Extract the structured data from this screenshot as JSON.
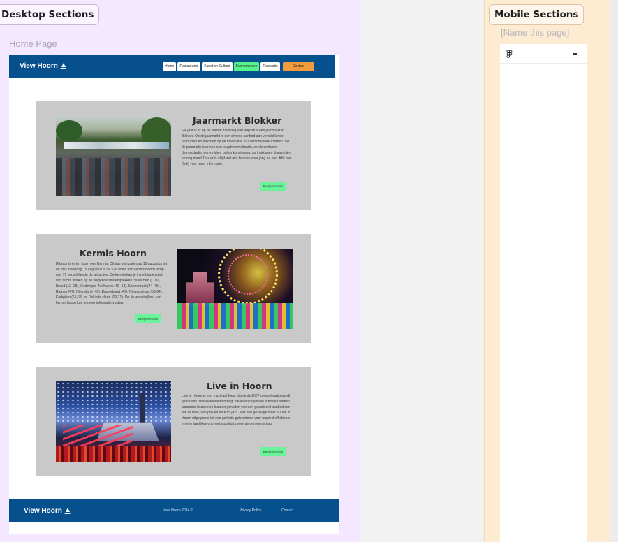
{
  "canvas": {
    "desktop_section_label": "Desktop Sections",
    "mobile_section_label": "Mobile Sections",
    "desktop_frame_label": "Home Page",
    "mobile_frame_label": "[Name this page]"
  },
  "navbar": {
    "logo": "View Hoorn",
    "links": [
      "Home",
      "Restaurants",
      "Kunst en Cultuur",
      "Evenementen",
      "Recreatie"
    ],
    "active_link": "Evenementen",
    "contact": "Contact"
  },
  "cards": [
    {
      "title": "Jaarmarkt Blokker",
      "text": "Elk jaar is er op de laatste zaterdag van augustus een jaarmarkt in Blokker. Op de jaarmarkt is een diverse aanbod aan verschillende producten en diensten op de maar liefs 200 verschillende kramen. Op de jaarmarkt is er ook een jeugdrommelmarkt, een brandweer demonstratie, pony rijden, ballon kunstenaar, springkussen draaimolen en nog meer! Dus er is altijd wel iets te doen voor jong en oud. Klik hier (link) voor meer informatie.",
      "button": "Bekijk website"
    },
    {
      "title": "Kermis Hoorn",
      "text": "Elk jaar is er in Hoorn een Kermis. Dit jaar van zaterdag 10 augustus tot en met maandag 19 augustus is de 578 editie van kermis Hoorn terug met 71 verschillende de attracties. De kermis kan je in de binnenstad van hoorn vinden op de volgende straten/plekken: Viale Hert (L 10), Breed (12 -28), Gedempte Turfhaven (49 -63), Spoorstraat (44 -45), Ramen (47), Nieuwland (48), Draverbuurt (47), Nieuwsstraat (58-64), Kerkplein (65-68) en Dal inde sleen (69-71). Op de website(link) van kermis hoorn kan je meer informatie vinden.",
      "button": "Bekijk website"
    },
    {
      "title": "Live in Hoorn",
      "text": "Live in Hoorn is een muzikaal feest dat sinds 2007 onregelmatig wordt gehouden. Het evenement brengt lokale en regionale artiesten samen, waardoor bezoekers kunnen genieten van een gevarieerd aanbod aan live muziek, van pop en rock tot jazz. Met een gezellige sfeer is Live in Hoorn uitgegroeid tot een geliefde gebeurtenis voor muziekliefhebbers en een jaarlijkse ontmoetingsplaats voor de gemeenschap.",
      "button": "Bekijk website"
    }
  ],
  "footer": {
    "logo": "View Hoorn",
    "copyright": "View Hoorn 2024 ©",
    "privacy": "Privacy Policy",
    "contact": "Contact"
  },
  "icons": {
    "logo_icon": "sailboat-icon",
    "mobile_logo_icon": "figma-icon",
    "mobile_menu_icon": "hamburger-menu-icon"
  },
  "colors": {
    "brand_blue": "#06508e",
    "active_green": "#57f28b",
    "contact_orange": "#f39a3c",
    "card_gray": "#c9c9c9",
    "desktop_section_bg": "#f3e8ff",
    "mobile_section_bg": "#fdebd2"
  }
}
